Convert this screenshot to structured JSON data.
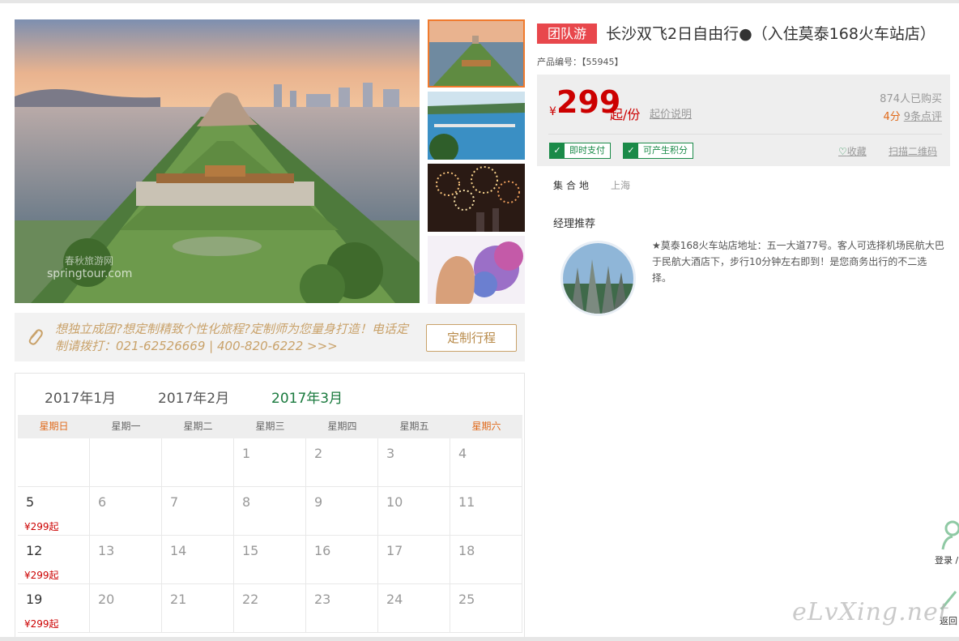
{
  "gallery": {
    "main_watermark": "springtour.com",
    "main_watermark_cn": "春秋旅游网"
  },
  "custom_banner": {
    "text": "想独立成团?想定制精致个性化旅程?定制师为您量身打造！电话定制请拨打：021-62526669 | 400-820-6222 >>>",
    "button_label": "定制行程"
  },
  "calendar": {
    "months": [
      "2017年1月",
      "2017年2月",
      "2017年3月"
    ],
    "active_month": "2017年3月",
    "weekdays": [
      "星期日",
      "星期一",
      "星期二",
      "星期三",
      "星期四",
      "星期五",
      "星期六"
    ],
    "rows": [
      [
        {
          "d": ""
        },
        {
          "d": ""
        },
        {
          "d": ""
        },
        {
          "d": "1"
        },
        {
          "d": "2"
        },
        {
          "d": "3"
        },
        {
          "d": "4"
        }
      ],
      [
        {
          "d": "5",
          "p": "¥299起"
        },
        {
          "d": "6"
        },
        {
          "d": "7"
        },
        {
          "d": "8"
        },
        {
          "d": "9"
        },
        {
          "d": "10"
        },
        {
          "d": "11"
        }
      ],
      [
        {
          "d": "12",
          "p": "¥299起"
        },
        {
          "d": "13"
        },
        {
          "d": "14"
        },
        {
          "d": "15"
        },
        {
          "d": "16"
        },
        {
          "d": "17"
        },
        {
          "d": "18"
        }
      ],
      [
        {
          "d": "19",
          "p": "¥299起"
        },
        {
          "d": "20"
        },
        {
          "d": "21"
        },
        {
          "d": "22"
        },
        {
          "d": "23"
        },
        {
          "d": "24"
        },
        {
          "d": "25"
        }
      ]
    ]
  },
  "product": {
    "tag": "团队游",
    "title": "长沙双飞2日自由行●（入住莫泰168火车站店）",
    "code": "产品编号：【55945】",
    "currency": "¥",
    "price": "299",
    "price_suffix": "起/份",
    "price_desc": "起价说明",
    "sold": "874人已购买",
    "score": "4分",
    "reviews": "9条点评",
    "badges": [
      "即时支付",
      "可产生积分"
    ],
    "favorite": "收藏",
    "qr": "扫描二维码",
    "gather_label": "集合地",
    "gather_value": "上海",
    "manager_title": "经理推荐",
    "manager_text": "★莫泰168火车站店地址：五一大道77号。客人可选择机场民航大巴于民航大酒店下，步行10分钟左右即到！是您商务出行的不二选择。"
  },
  "side": {
    "login": "登录 /",
    "back": "返回"
  },
  "watermark": "eLvXing.net"
}
